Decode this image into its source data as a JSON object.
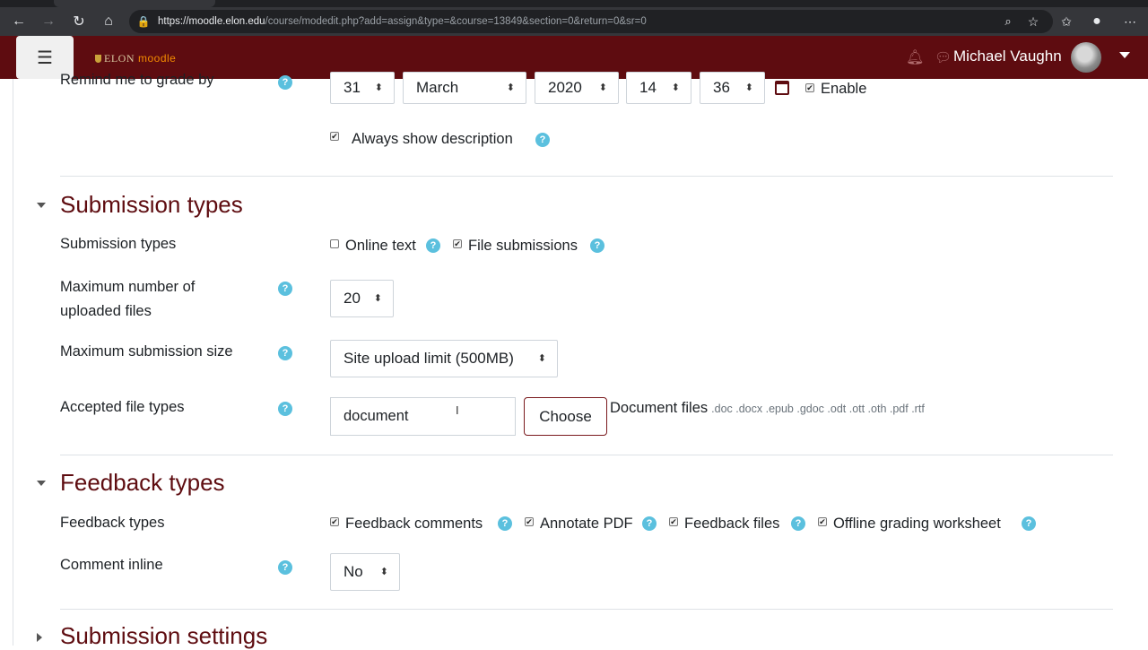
{
  "browser": {
    "url_host": "https://moodle.elon.edu",
    "url_path": "/course/modedit.php?add=assign&type=&course=13849&section=0&return=0&sr=0"
  },
  "navbar": {
    "brand": "ELON",
    "brand_app": "moodle",
    "user_name": "Michael Vaughn"
  },
  "dates": {
    "label": "Remind me to grade by",
    "day": "31",
    "month": "March",
    "year": "2020",
    "hour": "14",
    "minute": "36",
    "enable_label": "Enable",
    "always_show_label": "Always show description"
  },
  "submission_types": {
    "title": "Submission types",
    "row_label": "Submission types",
    "online_text": "Online text",
    "file_submissions": "File submissions",
    "max_files_label_1": "Maximum number of",
    "max_files_label_2": "uploaded files",
    "max_files_value": "20",
    "max_size_label": "Maximum submission size",
    "max_size_value": "Site upload limit (500MB)",
    "accepted_label": "Accepted file types",
    "accepted_value": "document",
    "choose_label": "Choose",
    "doc_files_label": "Document files",
    "doc_files_ext": ".doc .docx .epub .gdoc .odt .ott .oth .pdf .rtf"
  },
  "feedback_types": {
    "title": "Feedback types",
    "row_label": "Feedback types",
    "comments": "Feedback comments",
    "annotate": "Annotate PDF",
    "files": "Feedback files",
    "offline": "Offline grading worksheet",
    "inline_label": "Comment inline",
    "inline_value": "No"
  },
  "submission_settings": {
    "title": "Submission settings"
  },
  "icons": {
    "help": "?",
    "checkmark": "✔",
    "select_arrows": "⬍"
  }
}
